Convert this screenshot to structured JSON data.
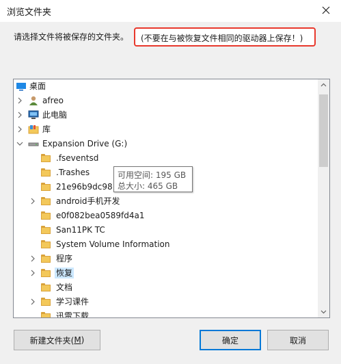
{
  "window": {
    "title": "浏览文件夹"
  },
  "instruction": "请选择文件将被保存的文件夹。",
  "warning": "(不要在与被恢复文件相同的驱动器上保存！)",
  "tree": {
    "items": [
      {
        "label": "桌面",
        "icon": "desktop-icon"
      },
      {
        "label": "afreo",
        "icon": "user-icon"
      },
      {
        "label": "此电脑",
        "icon": "computer-icon"
      },
      {
        "label": "库",
        "icon": "library-icon"
      },
      {
        "label": "Expansion Drive (G:)",
        "icon": "drive-icon"
      },
      {
        "label": ".fseventsd",
        "icon": "folder-icon"
      },
      {
        "label": ".Trashes",
        "icon": "folder-icon"
      },
      {
        "label": "21e96b9dc98",
        "icon": "folder-icon"
      },
      {
        "label": "android手机开发",
        "icon": "folder-icon"
      },
      {
        "label": "e0f082bea0589fd4a1",
        "icon": "folder-icon"
      },
      {
        "label": "San11PK TC",
        "icon": "folder-icon"
      },
      {
        "label": "System Volume Information",
        "icon": "folder-icon"
      },
      {
        "label": "程序",
        "icon": "folder-icon"
      },
      {
        "label": "恢复",
        "icon": "folder-icon",
        "selected": true
      },
      {
        "label": "文档",
        "icon": "folder-icon"
      },
      {
        "label": "学习课件",
        "icon": "folder-icon"
      },
      {
        "label": "迅雷下载",
        "icon": "folder-icon"
      }
    ]
  },
  "tooltip": {
    "line1": "可用空间: 195 GB",
    "line2": "总大小: 465 GB"
  },
  "buttons": {
    "new_folder_text": "新建文件夹(",
    "new_folder_key": "M",
    "new_folder_end": ")",
    "ok": "确定",
    "cancel": "取消"
  },
  "colors": {
    "warning_border": "#e8382c",
    "selection": "#cce8ff",
    "primary_border": "#0078d7"
  }
}
